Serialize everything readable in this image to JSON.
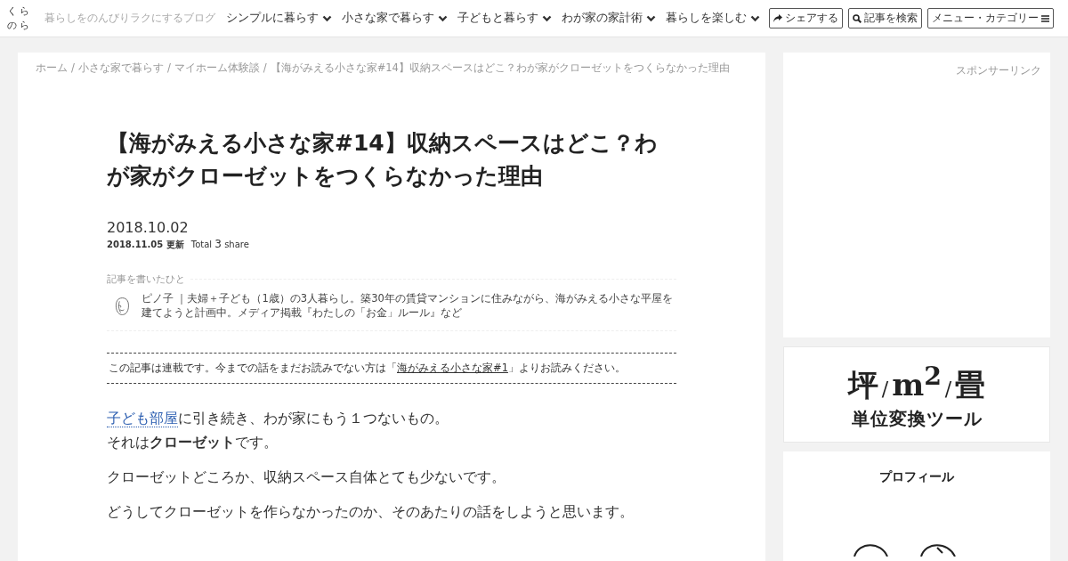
{
  "header": {
    "logo": [
      "く",
      "ら",
      "の",
      "ら"
    ],
    "tagline": "暮らしをのんびりラクにするブログ",
    "nav": [
      {
        "label": "シンプルに暮らす"
      },
      {
        "label": "小さな家で暮らす"
      },
      {
        "label": "子どもと暮らす"
      },
      {
        "label": "わが家の家計術"
      },
      {
        "label": "暮らしを楽しむ"
      }
    ],
    "buttons": [
      {
        "kind": "share",
        "label": "シェアする"
      },
      {
        "kind": "search",
        "label": "記事を検索"
      },
      {
        "kind": "menu",
        "label": "メニュー・カテゴリー"
      }
    ]
  },
  "breadcrumb_separator": "/",
  "breadcrumb": [
    "ホーム",
    "小さな家で暮らす",
    "マイホーム体験談",
    "【海がみえる小さな家#14】収納スペースはどこ？わが家がクローゼットをつくらなかった理由"
  ],
  "article": {
    "title": "【海がみえる小さな家#14】収納スペースはどこ？わが家がクローゼットをつくらなかった理由",
    "date": "2018.10.02",
    "updated": "2018.11.05 更新",
    "share_prefix": "Total",
    "share_count": "3",
    "share_suffix": "share",
    "author": {
      "heading": "記事を書いたひと",
      "bio": "ピノ子 ｜夫婦＋子ども（1歳）の3人暮らし。築30年の賃貸マンションに住みながら、海がみえる小さな平屋を建てようと計画中。メディア掲載『わたしの「お金」ルール』など"
    },
    "notice": {
      "before": "この記事は連載です。今までの話をまだお読みでない方は「",
      "link": "海がみえる小さな家#1",
      "after": "」よりお読みください。"
    },
    "paragraphs": [
      {
        "link": "子ども部屋",
        "lines": [
          "に引き続き、わが家にもう１つないもの。",
          "それは**クローゼット**です。"
        ]
      },
      {
        "lines": [
          "クローゼットどころか、収納スペース自体とても少ないです。"
        ]
      },
      {
        "lines": [
          "どうしてクローゼットを作らなかったのか、そのあたりの話をしようと思います。"
        ]
      }
    ]
  },
  "sidebar": {
    "ad_label": "スポンサーリンク",
    "banner": {
      "title": [
        "坪",
        "/",
        "m$^{2}$",
        "/",
        "畳"
      ],
      "subtitle": "単位変換ツール"
    },
    "profile": {
      "heading": "プロフィール"
    }
  }
}
